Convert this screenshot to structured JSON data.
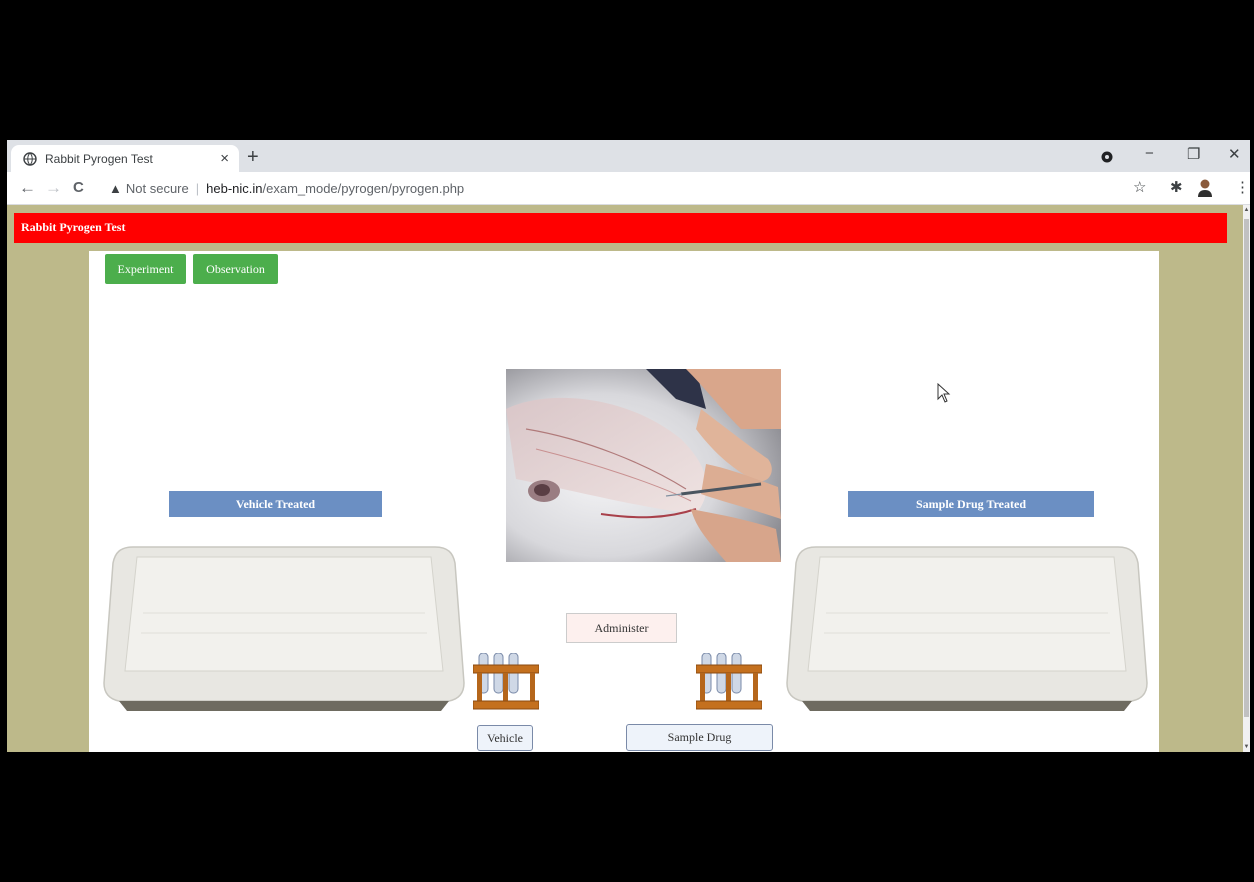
{
  "browser": {
    "tab_title": "Rabbit Pyrogen Test",
    "tab_close": "×",
    "new_tab": "+",
    "window_controls": {
      "minimize": "−",
      "restore": "❐",
      "close": "✕"
    },
    "nav": {
      "back": "←",
      "forward": "→",
      "reload": "C"
    },
    "omnibox": {
      "warning_icon": "▲",
      "security_label": "Not secure",
      "host": "heb-nic.in",
      "path": "/exam_mode/pyrogen/pyrogen.php"
    },
    "toolbar_icons": {
      "star": "☆",
      "extensions": "✱",
      "menu": "⋮"
    }
  },
  "page": {
    "header_title": "Rabbit Pyrogen Test",
    "tabs": [
      "Experiment",
      "Observation"
    ],
    "vehicle_treated_label": "Vehicle Treated",
    "sample_treated_label": "Sample Drug Treated",
    "administer_label": "Administer",
    "vehicle_label": "Vehicle",
    "sample_drug_label": "Sample Drug"
  },
  "colors": {
    "header": "#ff0000",
    "green_button": "#4cae4c",
    "blue_label": "#6b8fc3",
    "page_background": "#bdb98a"
  }
}
